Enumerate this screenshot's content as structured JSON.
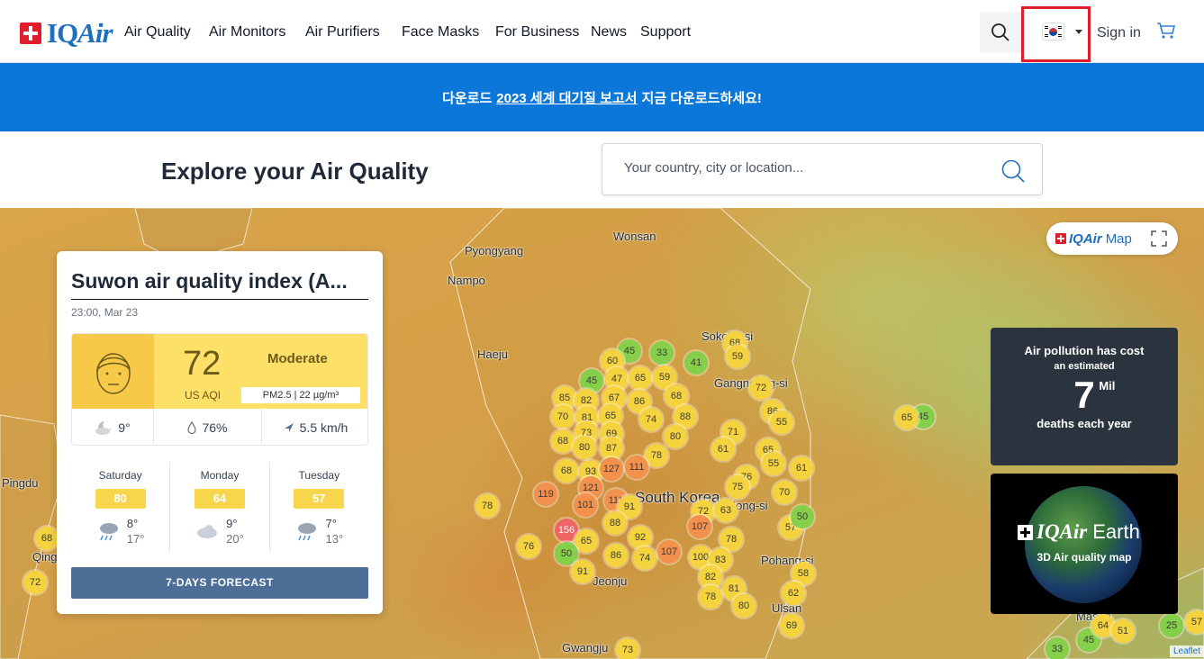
{
  "nav": {
    "menu": [
      "Air Quality",
      "Air Monitors",
      "Air Purifiers",
      "Face Masks",
      "For Business",
      "News",
      "Support"
    ],
    "sign_in": "Sign in"
  },
  "banner": {
    "pre": "다운로드",
    "link": "2023 세계 대기질 보고서",
    "post": "지금 다운로드하세요!"
  },
  "explore": {
    "title": "Explore your Air Quality",
    "search_placeholder": "Your country, city or location..."
  },
  "map": {
    "badge_bold": "IQAir",
    "badge_light": "Map",
    "labels": [
      {
        "text": "Pyongyang"
      },
      {
        "text": "Wonsan"
      },
      {
        "text": "Nampo"
      },
      {
        "text": "Haeju"
      },
      {
        "text": "Sokcho-si"
      },
      {
        "text": "Gangneung-si"
      },
      {
        "text": "South Korea"
      },
      {
        "text": "Andong-si"
      },
      {
        "text": "Jeonju"
      },
      {
        "text": "Pohang-si"
      },
      {
        "text": "Pingdu"
      },
      {
        "text": "Qingdao"
      },
      {
        "text": "Gwangju"
      },
      {
        "text": "Ulsan"
      },
      {
        "text": "Masan"
      }
    ],
    "markers": [
      {
        "v": "45",
        "c": "g"
      },
      {
        "v": "33",
        "c": "g"
      },
      {
        "v": "60",
        "c": "y"
      },
      {
        "v": "41",
        "c": "g"
      },
      {
        "v": "45",
        "c": "g"
      },
      {
        "v": "47",
        "c": "y"
      },
      {
        "v": "65",
        "c": "y"
      },
      {
        "v": "59",
        "c": "y"
      },
      {
        "v": "68",
        "c": "y"
      },
      {
        "v": "59",
        "c": "y"
      },
      {
        "v": "85",
        "c": "y"
      },
      {
        "v": "82",
        "c": "y"
      },
      {
        "v": "67",
        "c": "y"
      },
      {
        "v": "86",
        "c": "y"
      },
      {
        "v": "68",
        "c": "y"
      },
      {
        "v": "72",
        "c": "y"
      },
      {
        "v": "70",
        "c": "y"
      },
      {
        "v": "81",
        "c": "y"
      },
      {
        "v": "65",
        "c": "y"
      },
      {
        "v": "74",
        "c": "y"
      },
      {
        "v": "88",
        "c": "y"
      },
      {
        "v": "86",
        "c": "y"
      },
      {
        "v": "73",
        "c": "y"
      },
      {
        "v": "69",
        "c": "y"
      },
      {
        "v": "80",
        "c": "y"
      },
      {
        "v": "71",
        "c": "y"
      },
      {
        "v": "55",
        "c": "y"
      },
      {
        "v": "45",
        "c": "g"
      },
      {
        "v": "68",
        "c": "y"
      },
      {
        "v": "80",
        "c": "y"
      },
      {
        "v": "87",
        "c": "y"
      },
      {
        "v": "78",
        "c": "y"
      },
      {
        "v": "61",
        "c": "y"
      },
      {
        "v": "65",
        "c": "y"
      },
      {
        "v": "55",
        "c": "y"
      },
      {
        "v": "61",
        "c": "y"
      },
      {
        "v": "68",
        "c": "y"
      },
      {
        "v": "93",
        "c": "y"
      },
      {
        "v": "127",
        "c": "o"
      },
      {
        "v": "111",
        "c": "o"
      },
      {
        "v": "76",
        "c": "y"
      },
      {
        "v": "75",
        "c": "y"
      },
      {
        "v": "119",
        "c": "o"
      },
      {
        "v": "121",
        "c": "o"
      },
      {
        "v": "70",
        "c": "y"
      },
      {
        "v": "78",
        "c": "y"
      },
      {
        "v": "101",
        "c": "o"
      },
      {
        "v": "111",
        "c": "o"
      },
      {
        "v": "91",
        "c": "y"
      },
      {
        "v": "72",
        "c": "y"
      },
      {
        "v": "63",
        "c": "y"
      },
      {
        "v": "156",
        "c": "r"
      },
      {
        "v": "88",
        "c": "y"
      },
      {
        "v": "107",
        "c": "o"
      },
      {
        "v": "57",
        "c": "y"
      },
      {
        "v": "50",
        "c": "g"
      },
      {
        "v": "65",
        "c": "y"
      },
      {
        "v": "92",
        "c": "y"
      },
      {
        "v": "78",
        "c": "y"
      },
      {
        "v": "76",
        "c": "y"
      },
      {
        "v": "50",
        "c": "g"
      },
      {
        "v": "86",
        "c": "y"
      },
      {
        "v": "74",
        "c": "y"
      },
      {
        "v": "107",
        "c": "o"
      },
      {
        "v": "100",
        "c": "y"
      },
      {
        "v": "83",
        "c": "y"
      },
      {
        "v": "58",
        "c": "y"
      },
      {
        "v": "91",
        "c": "y"
      },
      {
        "v": "82",
        "c": "y"
      },
      {
        "v": "81",
        "c": "y"
      },
      {
        "v": "62",
        "c": "y"
      },
      {
        "v": "78",
        "c": "y"
      },
      {
        "v": "80",
        "c": "y"
      },
      {
        "v": "69",
        "c": "y"
      },
      {
        "v": "68",
        "c": "y"
      },
      {
        "v": "72",
        "c": "y"
      },
      {
        "v": "65",
        "c": "y"
      },
      {
        "v": "73",
        "c": "y"
      },
      {
        "v": "45",
        "c": "g"
      },
      {
        "v": "64",
        "c": "y"
      },
      {
        "v": "51",
        "c": "y"
      },
      {
        "v": "33",
        "c": "g"
      },
      {
        "v": "25",
        "c": "g"
      },
      {
        "v": "57",
        "c": "y"
      }
    ],
    "leaflet": "Leaflet"
  },
  "card": {
    "title": "Suwon air quality index (A...",
    "time": "23:00, Mar 23",
    "aqi": "72",
    "aqi_unit": "US AQI",
    "level": "Moderate",
    "pm": "PM2.5 | 22 µg/m³",
    "temp": "9°",
    "humidity": "76%",
    "wind": "5.5 km/h",
    "forecast": [
      {
        "day": "Saturday",
        "aqi": "80",
        "hi": "8°",
        "lo": "17°"
      },
      {
        "day": "Monday",
        "aqi": "64",
        "hi": "9°",
        "lo": "20°"
      },
      {
        "day": "Tuesday",
        "aqi": "57",
        "hi": "7°",
        "lo": "13°"
      }
    ],
    "button": "7-DAYS FORECAST"
  },
  "cost_card": {
    "line1": "Air pollution has cost",
    "line2": "an estimated",
    "number": "7",
    "unit": "Mil",
    "line4": "deaths each year"
  },
  "earth_card": {
    "bold": "IQAir",
    "light": "Earth",
    "sub": "3D Air quality map"
  },
  "colors": {
    "brand_blue": "#0b77d8",
    "brand_red": "#e11d2b",
    "aqi_moderate": "#fde068"
  }
}
